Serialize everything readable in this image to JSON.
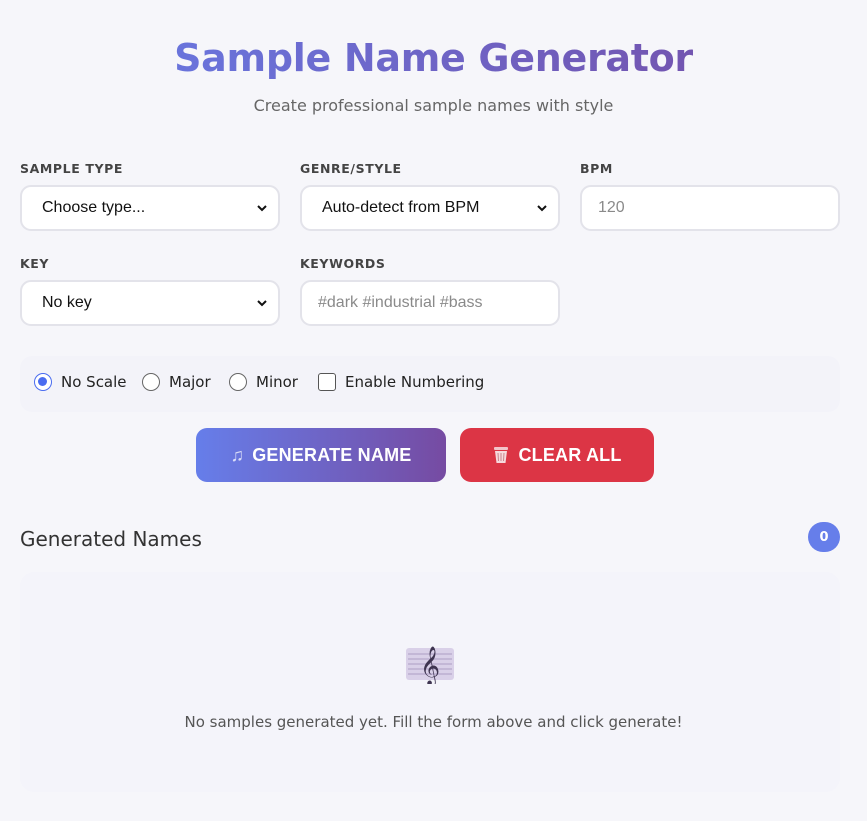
{
  "header": {
    "title": "Sample Name Generator",
    "subtitle": "Create professional sample names with style"
  },
  "form": {
    "sample_type": {
      "label": "SAMPLE TYPE",
      "value": "Choose type..."
    },
    "genre": {
      "label": "GENRE/STYLE",
      "value": "Auto-detect from BPM"
    },
    "bpm": {
      "label": "BPM",
      "placeholder": "120"
    },
    "key": {
      "label": "KEY",
      "value": "No key"
    },
    "keywords": {
      "label": "KEYWORDS",
      "placeholder": "#dark #industrial #bass"
    }
  },
  "options": {
    "no_scale": {
      "label": "No Scale",
      "checked": true
    },
    "major": {
      "label": "Major",
      "checked": false
    },
    "minor": {
      "label": "Minor",
      "checked": false
    },
    "numbering": {
      "label": "Enable Numbering",
      "checked": false
    }
  },
  "actions": {
    "generate": {
      "label": "GENERATE NAME",
      "icon": "music-notes-icon"
    },
    "clear": {
      "label": "CLEAR ALL",
      "icon": "wastebasket-icon"
    }
  },
  "results": {
    "title": "Generated Names",
    "count": "0",
    "empty_icon": "treble-clef-icon",
    "empty_text": "No samples generated yet. Fill the form above and click generate!"
  },
  "colors": {
    "accent_start": "#667eea",
    "accent_end": "#764ba2",
    "danger": "#dc3545"
  }
}
